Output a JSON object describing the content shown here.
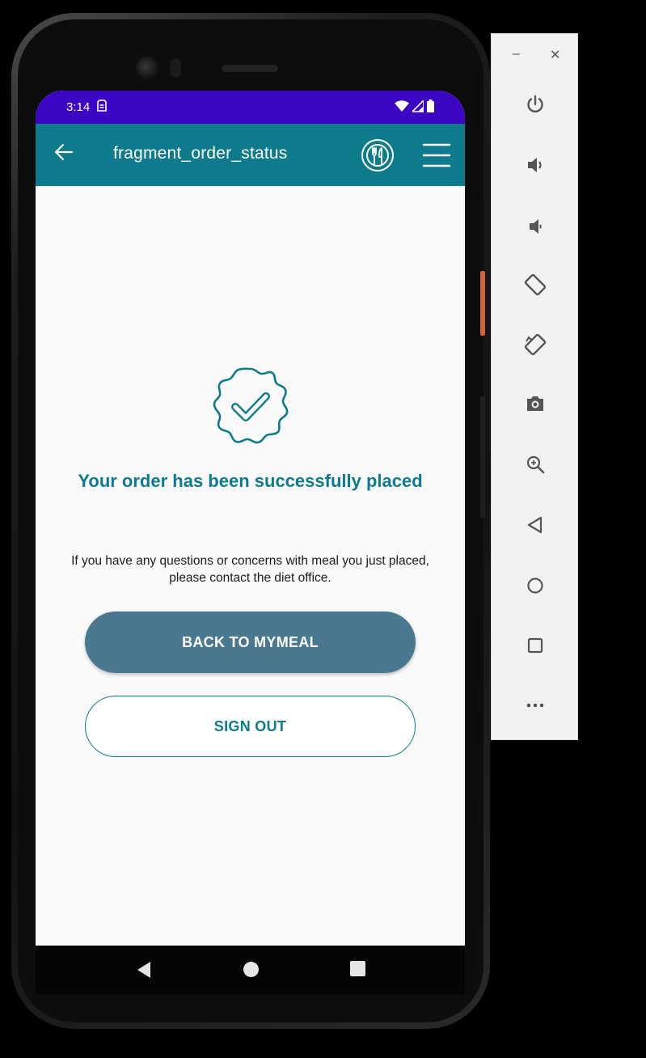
{
  "status_bar": {
    "time": "3:14"
  },
  "app_bar": {
    "title": "fragment_order_status"
  },
  "confirmation": {
    "headline": "Your order has been successfully placed",
    "message": "If you have any questions or concerns with meal you just placed, please contact the diet office."
  },
  "buttons": {
    "back_label": "BACK TO MYMEAL",
    "sign_out_label": "SIGN OUT"
  },
  "colors": {
    "status_bar": "#3a06c4",
    "app_bar": "#0d7b8c",
    "accent": "#0d7b8c",
    "primary_button": "#4a7891"
  },
  "icons": {
    "app_bar": [
      "back-arrow-icon",
      "meal-plate-icon",
      "hamburger-menu-icon"
    ],
    "confirmation": "verified-check-badge-icon",
    "nav_bar": [
      "nav-back-icon",
      "nav-home-icon",
      "nav-recents-icon"
    ],
    "emulator_toolbar": [
      "power-icon",
      "volume-up-icon",
      "volume-down-icon",
      "rotate-left-icon",
      "rotate-right-icon",
      "camera-icon",
      "zoom-icon",
      "back-icon",
      "home-icon",
      "overview-icon",
      "more-icon"
    ]
  }
}
